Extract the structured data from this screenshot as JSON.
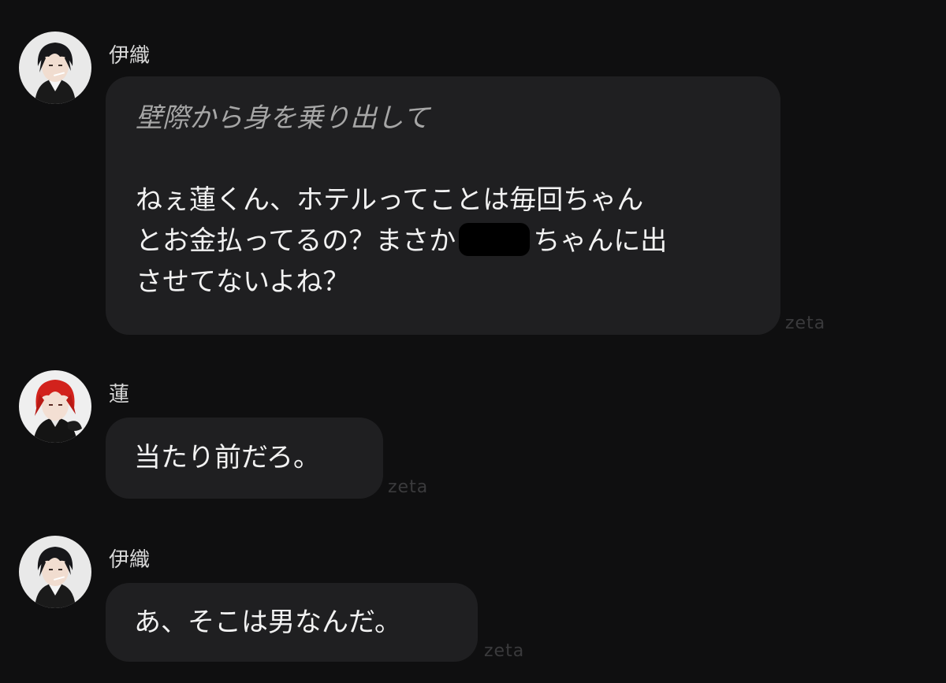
{
  "messages": [
    {
      "sender": "伊織",
      "avatar_icon": "dark-haired-character-avatar",
      "narration": "壁際から身を乗り出して",
      "line1": "ねぇ蓮くん、ホテルってことは毎回ちゃん",
      "line2_before": "とお金払ってるの？まさか",
      "line2_after": "ちゃんに出",
      "line3": "させてないよね？",
      "watermark": "zeta"
    },
    {
      "sender": "蓮",
      "avatar_icon": "red-haired-character-avatar",
      "text": "当たり前だろ。",
      "watermark": "zeta"
    },
    {
      "sender": "伊織",
      "avatar_icon": "dark-haired-character-avatar",
      "text": "あ、そこは男なんだ。",
      "watermark": "zeta"
    }
  ],
  "colors": {
    "background": "#0f0f10",
    "bubble": "#1f1f21",
    "narration": "#a6a6a6",
    "watermark": "#3a3a3c"
  }
}
